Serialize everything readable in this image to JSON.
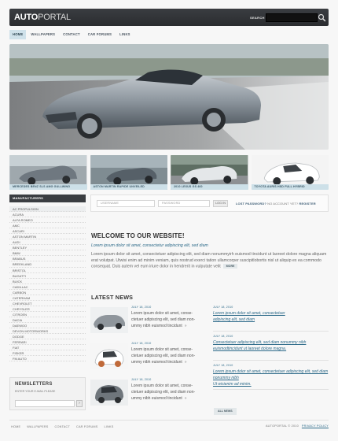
{
  "header": {
    "logo_bold": "AUTO",
    "logo_thin": "PORTAL",
    "search_label": "SEARCH",
    "search_value": ""
  },
  "nav": [
    "HOME",
    "WALLPAPERS",
    "CONTACT",
    "CAR FORUMS",
    "LINKS"
  ],
  "thumbs": [
    "MERCEDES BENZ SLS AMG GULLWING",
    "ASTON MARTIN RAPIDE UNVEILED",
    "2010 LEXUS GS 460",
    "TOYOTA AURIS HSD FULL HYBRID"
  ],
  "sidebar": {
    "title": "MANUFACTURERS",
    "items": [
      "AC PROPULSION",
      "ACURA",
      "ALFA ROMEO",
      "AMC",
      "ASCARI",
      "ASTON MARTIN",
      "AUDI",
      "BENTLEY",
      "BMW",
      "BRABUS",
      "BREEKLAND",
      "BRISTOL",
      "BUGATTI",
      "BUICK",
      "CADILLAC",
      "CARBON",
      "CATERHAM",
      "CHEVROLET",
      "CHRYSLER",
      "CITROEN",
      "DACIA",
      "DAEWOO",
      "DEVON MOTORWORKS",
      "DODGE",
      "FERRARI",
      "FIAT",
      "FISKER",
      "FM AUTO"
    ]
  },
  "newsletter": {
    "title": "NEWSLETTERS",
    "label": "ENTER YOUR E-MAIL PLEASE",
    "button": "›"
  },
  "login": {
    "username": "USERNAME",
    "password": "PASSWORD",
    "button": "LOG IN",
    "lost": "LOST PASSWORD?",
    "no_account": "NO ACCOUNT YET?",
    "register": "REGISTER"
  },
  "welcome": {
    "title": "WELCOME TO OUR WEBSITE!",
    "subtitle": "Lorem ipsum dolor sit amet, consectetur adipiscing elit, sed diam",
    "body": "Lorem ipsum dolor sit amet, consectetuer adipiscing elit, sed diam nonummyirh euismod tincidunt ut laoreet dolore magna aliquam erat volutpat. Utwisi enim ad minim veniam, quis nostrud exerci tation ullamcorper suscipitlobortis nisl ut aliquip ex ea commodo consequat. Duis autem vel eum iriure dolor in hendrerit in vulputate velit",
    "more": "MORE"
  },
  "news": {
    "title": "LATEST NEWS",
    "items": [
      {
        "date": "JULY 18, 2010",
        "l1": "Lorem ipsum dolor sit amet, conse-",
        "l2": "ctetuer adipiscing elit, sed diam non-",
        "l3": "ummy nibh euismod tincidunt"
      },
      {
        "date": "JULY 18, 2010",
        "l1": "Lorem ipsum dolor sit amet, conse-",
        "l2": "ctetuer adipiscing elit, sed diam non-",
        "l3": "ummy nibh euismod tincidunt"
      },
      {
        "date": "JULY 18, 2010",
        "l1": "Lorem ipsum dolor sit amet, conse-",
        "l2": "ctetuer adipiscing elit, sed diam non-",
        "l3": "ummy nibh euismod tincidunt"
      }
    ],
    "arrows": "»",
    "right": [
      {
        "date": "JULY 18, 2010",
        "l1": "Lorem ipsum dolor sit amet, consectetuer",
        "l2": "adipiscing elit, sed diam"
      },
      {
        "date": "JULY 18, 2010",
        "l1": "Consectetuer adipiscing elit, sed diam nonummy nibh",
        "l2": "euismodtincidunt ut laoreet dolore magna."
      },
      {
        "date": "JULY 18, 2010",
        "l1": "Lorem ipsum dolor sit amet, consectetuer adipiscing elit, sed diam nonummy nibh",
        "l2": "Ut wisienim ad minim."
      }
    ],
    "all": "ALL NEWS"
  },
  "footer": {
    "nav": [
      "HOME",
      "WALLPAPERS",
      "CONTACT",
      "CAR FORUMS",
      "LINKS"
    ],
    "copyright": "AUTOPORTAL © 2010",
    "privacy": "PRIVACY POLICY"
  }
}
